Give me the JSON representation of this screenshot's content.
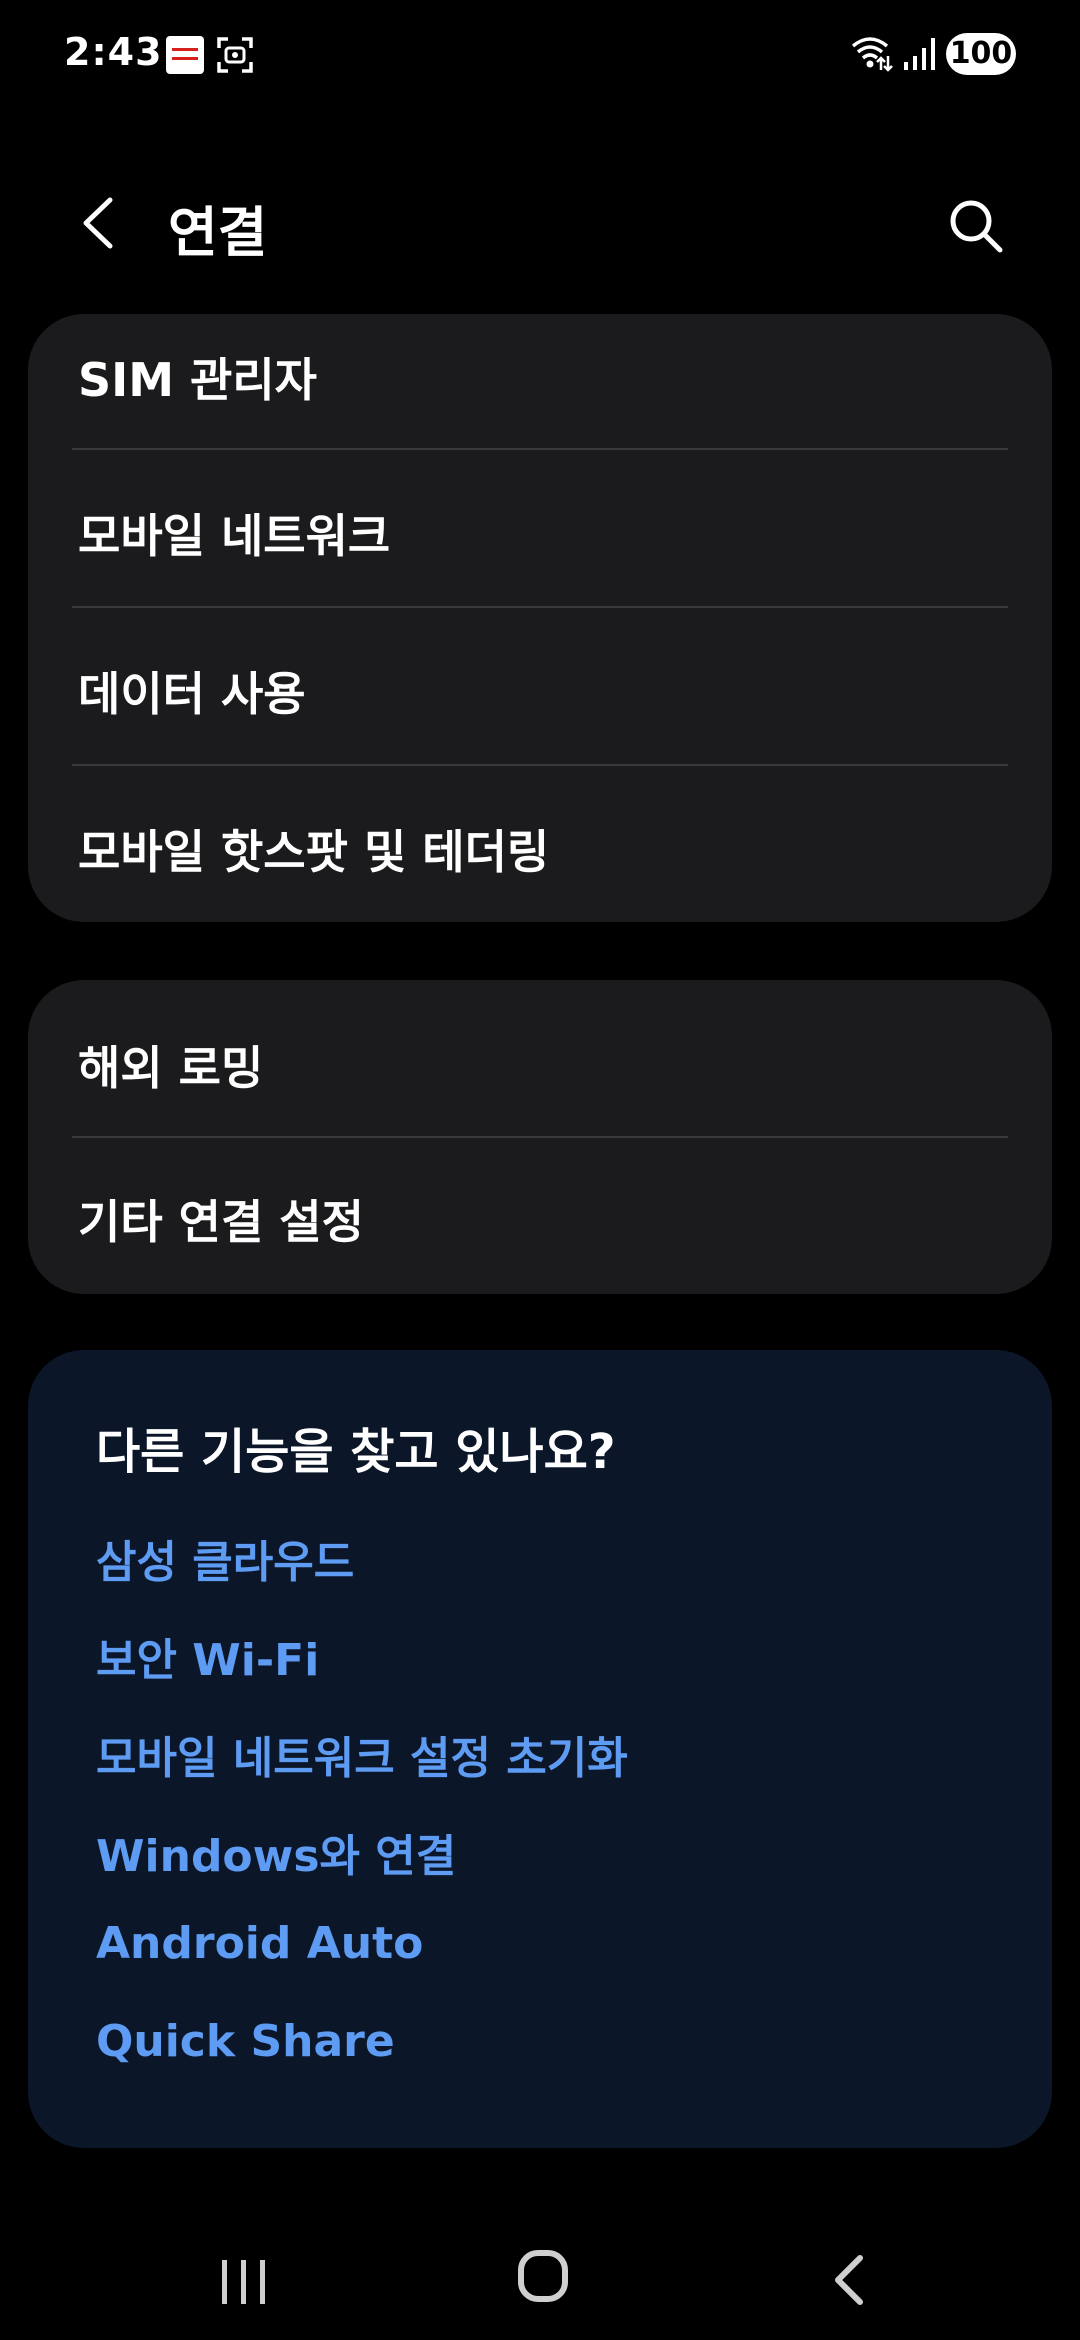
{
  "status_bar": {
    "time": "2:43",
    "battery": "100",
    "icons": [
      "app-notification-icon",
      "screen-capture-icon",
      "wifi-icon",
      "signal-icon"
    ]
  },
  "header": {
    "title": "연결",
    "back_icon": "chevron-left-icon",
    "search_icon": "search-icon"
  },
  "group1": {
    "items": [
      {
        "label": "SIM 관리자"
      },
      {
        "label": "모바일 네트워크"
      },
      {
        "label": "데이터 사용"
      },
      {
        "label": "모바일 핫스팟 및 테더링"
      }
    ]
  },
  "group2": {
    "items": [
      {
        "label": "해외 로밍"
      },
      {
        "label": "기타 연결 설정"
      }
    ]
  },
  "suggestions": {
    "title": "다른 기능을 찾고 있나요?",
    "links": [
      {
        "label": "삼성 클라우드"
      },
      {
        "label": "보안 Wi-Fi"
      },
      {
        "label": "모바일 네트워크 설정 초기화"
      },
      {
        "label": "Windows와 연결"
      },
      {
        "label": "Android Auto"
      },
      {
        "label": "Quick Share"
      }
    ]
  },
  "colors": {
    "background": "#000000",
    "card": "#1b1b1d",
    "suggest_card": "#0b1629",
    "link": "#5e9bf2",
    "divider": "#3a3a3c"
  },
  "nav_bar": {
    "icons": [
      "recents-icon",
      "home-icon",
      "back-icon"
    ]
  }
}
